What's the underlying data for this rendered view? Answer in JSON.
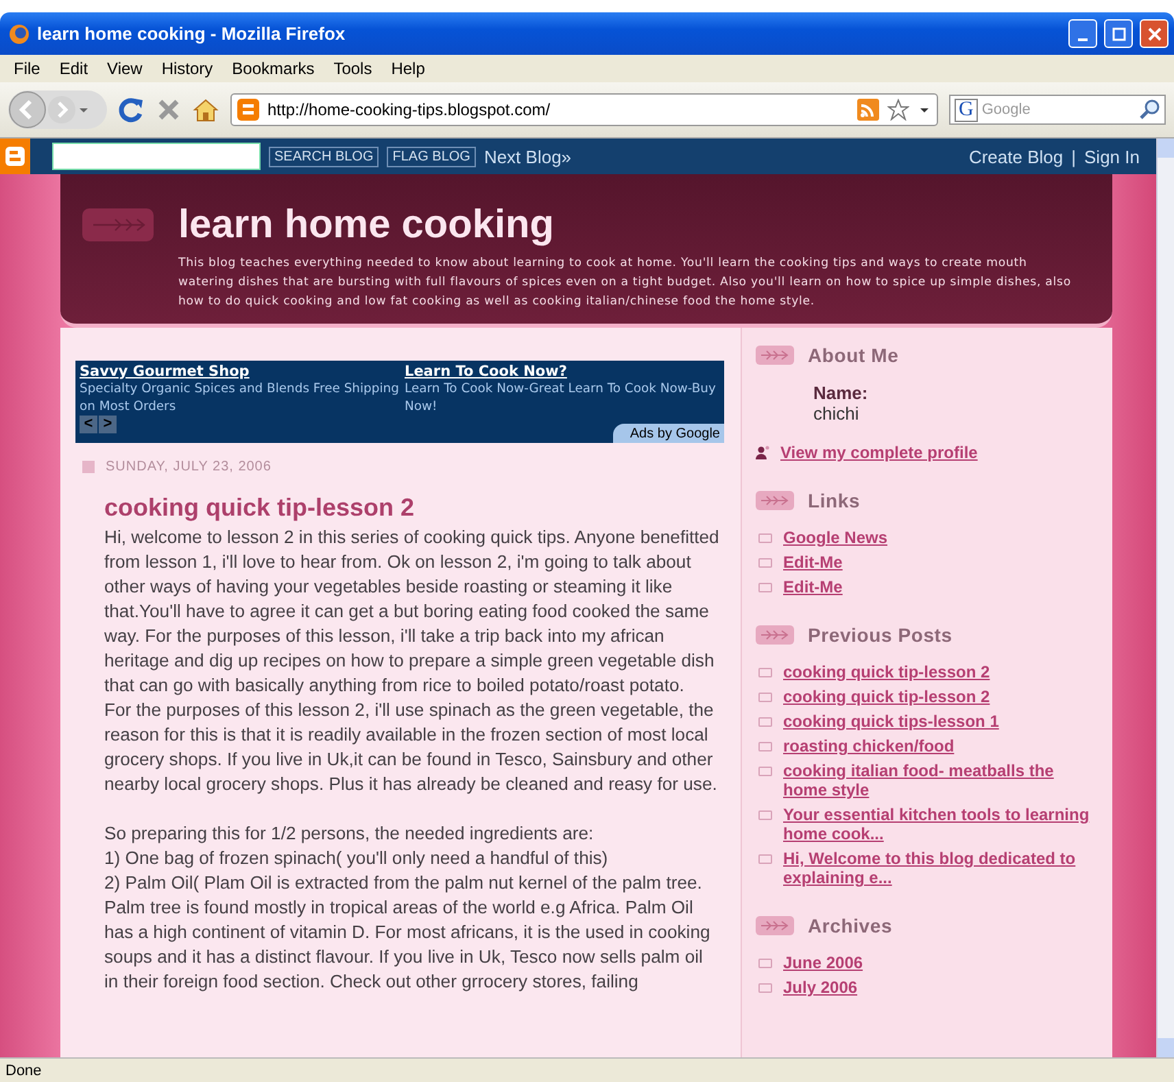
{
  "window": {
    "title": "learn home cooking - Mozilla Firefox"
  },
  "menu": [
    "File",
    "Edit",
    "View",
    "History",
    "Bookmarks",
    "Tools",
    "Help"
  ],
  "address_bar": {
    "value": "http://home-cooking-tips.blogspot.com/"
  },
  "search_box": {
    "engine": "G",
    "placeholder": "Google"
  },
  "blogger_bar": {
    "search_button": "SEARCH BLOG",
    "flag_button": "FLAG BLOG",
    "next_link": "Next Blog»",
    "create_link": "Create Blog",
    "separator": "|",
    "sign_in_link": "Sign In"
  },
  "header": {
    "title": "learn home cooking",
    "description": "This blog teaches everything needed to know about learning to cook at home. You'll learn the cooking tips and ways to create mouth watering dishes that are bursting with full flavours of spices even on a tight budget. Also you'll learn on how to spice up simple dishes, also how to do quick cooking and low fat cooking as well as cooking italian/chinese food the home style."
  },
  "ads": {
    "items": [
      {
        "title": "Savvy Gourmet Shop",
        "text": "Specialty Organic Spices and Blends Free Shipping on Most Orders"
      },
      {
        "title": "Learn To Cook Now?",
        "text": "Learn To Cook Now-Great Learn To Cook Now-Buy Now!"
      }
    ],
    "prev": "<",
    "next": ">",
    "credit": "Ads by Google"
  },
  "post": {
    "date": "SUNDAY, JULY 23, 2006",
    "title": "cooking quick tip-lesson 2",
    "paragraphs": [
      "Hi, welcome to lesson 2 in this series of cooking quick tips. Anyone benefitted from lesson 1, i'll love to hear from. Ok on lesson 2, i'm going to talk about other ways of having your vegetables beside roasting or steaming it like that.You'll have to agree it can get a but boring eating food cooked the same way. For the purposes of this lesson, i'll take a trip back into my african heritage and dig up recipes on how to prepare a simple green vegetable dish that can go with basically anything from rice to boiled potato/roast potato.",
      "For the purposes of this lesson 2, i'll use spinach as the green vegetable, the reason for this is that it is readily available in the frozen section of most local grocery shops. If you live in Uk,it can be found in Tesco, Sainsbury and other nearby local grocery shops. Plus it has already be cleaned and reasy for use.",
      "So preparing this for 1/2 persons, the needed ingredients are:",
      "1) One bag of frozen spinach( you'll only need a handful of this)",
      "2) Palm Oil( Plam Oil is extracted from the palm nut kernel of the palm tree. Palm tree is found mostly in tropical areas of the world e.g Africa. Palm Oil has a high continent of vitamin D. For most africans, it is the used in cooking soups and it has a distinct flavour. If you live in Uk, Tesco now sells palm oil in their foreign food section. Check out other grrocery stores, failing"
    ]
  },
  "sidebar": {
    "about": {
      "heading": "About Me",
      "name_label": "Name:",
      "name": "chichi",
      "profile_link": "View my complete profile"
    },
    "links": {
      "heading": "Links",
      "items": [
        "Google News",
        "Edit-Me",
        "Edit-Me"
      ]
    },
    "previous_posts": {
      "heading": "Previous Posts",
      "items": [
        "cooking quick tip-lesson 2",
        "cooking quick tip-lesson 2",
        "cooking quick tips-lesson 1",
        "roasting chicken/food",
        "cooking italian food- meatballs the home style",
        "Your essential kitchen tools to learning home cook...",
        "Hi, Welcome to this blog dedicated to explaining e..."
      ]
    },
    "archives": {
      "heading": "Archives",
      "items": [
        "June 2006",
        "July 2006"
      ]
    }
  },
  "status_bar": {
    "text": "Done"
  }
}
